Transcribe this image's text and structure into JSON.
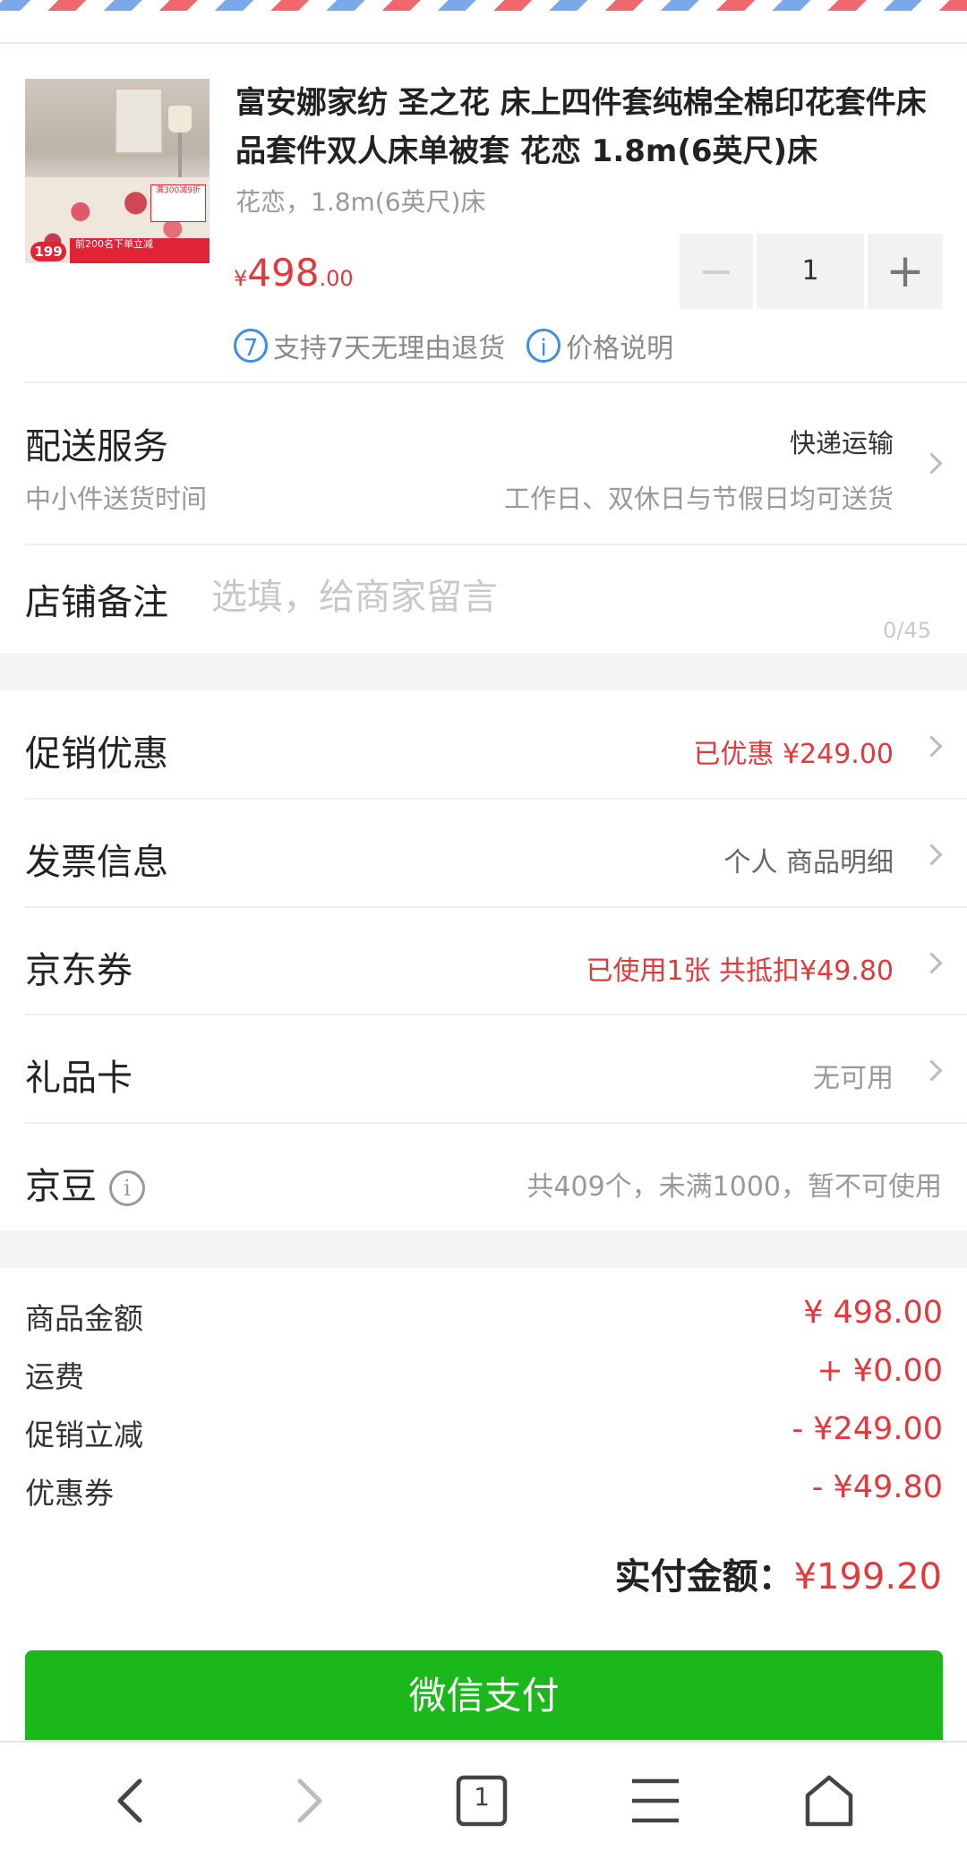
{
  "product": {
    "title": "富安娜家纺 圣之花 床上四件套纯棉全棉印花套件床品套件双人床单被套 花恋 1.8m(6英尺)床",
    "spec": "花恋，1.8m(6英尺)床",
    "price_currency": "¥",
    "price_int": "498",
    "price_dec": ".00",
    "quantity": "1",
    "minus_symbol": "−",
    "plus_symbol": "+",
    "return_badge": "7",
    "return_text": "支持7天无理由退货",
    "price_info_icon": "i",
    "price_info_text": "价格说明",
    "thumb_badge": "199",
    "thumb_promo": "前200名下单立减",
    "thumb_tag": "满300减9折"
  },
  "delivery": {
    "title": "配送服务",
    "method": "快递运输",
    "subtitle": "中小件送货时间",
    "schedule": "工作日、双休日与节假日均可送货"
  },
  "store_note": {
    "label": "店铺备注",
    "placeholder": "选填，给商家留言",
    "value": "",
    "counter": "0/45"
  },
  "rows": {
    "promotion": {
      "label": "促销优惠",
      "value": "已优惠 ¥249.00"
    },
    "invoice": {
      "label": "发票信息",
      "value": "个人 商品明细"
    },
    "coupon": {
      "label": "京东券",
      "value": "已使用1张 共抵扣¥49.80"
    },
    "giftcard": {
      "label": "礼品卡",
      "value": "无可用"
    },
    "jingdou": {
      "label": "京豆",
      "info_icon": "i",
      "value": "共409个，未满1000，暂不可使用"
    }
  },
  "summary": {
    "items": [
      {
        "label": "商品金额",
        "value": "¥ 498.00"
      },
      {
        "label": "运费",
        "value": "+ ¥0.00"
      },
      {
        "label": "促销立减",
        "value": "- ¥249.00"
      },
      {
        "label": "优惠券",
        "value": "- ¥49.80"
      }
    ],
    "total_label": "实付金额：",
    "total_value": "¥199.20"
  },
  "pay_button": "微信支付",
  "browser_nav": {
    "tab_count": "1",
    "icons": [
      "back-icon",
      "forward-icon",
      "tabs-icon",
      "menu-icon",
      "home-icon"
    ]
  },
  "colors": {
    "price_red": "#e4393c",
    "pay_green": "#1ab81a",
    "info_blue": "#3a8ee6"
  }
}
